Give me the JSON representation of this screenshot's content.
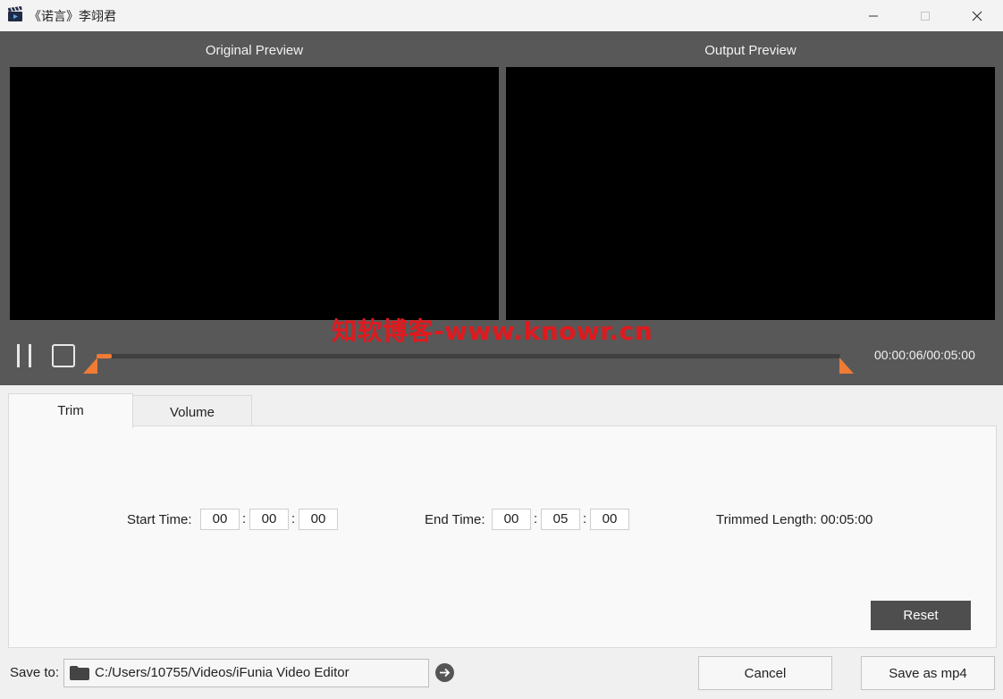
{
  "window": {
    "title": "《诺言》李翊君",
    "app_icon": "clapperboard-icon",
    "controls": [
      "minimize-icon",
      "maximize-icon",
      "close-icon"
    ]
  },
  "player": {
    "original_label": "Original Preview",
    "output_label": "Output Preview",
    "timecode": "00:00:06/00:05:00",
    "progress_fraction": 0.02,
    "watermark": "知软博客-www.knowr.cn",
    "colors": {
      "accent": "#f07b35",
      "background": "#585858",
      "screen": "#000000"
    }
  },
  "tabs": [
    {
      "label": "Trim",
      "active": true
    },
    {
      "label": "Volume",
      "active": false
    }
  ],
  "trim": {
    "start_label": "Start Time:",
    "start": {
      "h": "00",
      "m": "00",
      "s": "00"
    },
    "end_label": "End Time:",
    "end": {
      "h": "00",
      "m": "05",
      "s": "00"
    },
    "trimmed_length": "Trimmed Length: 00:05:00",
    "reset_label": "Reset"
  },
  "footer": {
    "save_to_label": "Save to:",
    "path": "C:/Users/10755/Videos/iFunia Video Editor",
    "cancel_label": "Cancel",
    "save_label": "Save as mp4"
  }
}
